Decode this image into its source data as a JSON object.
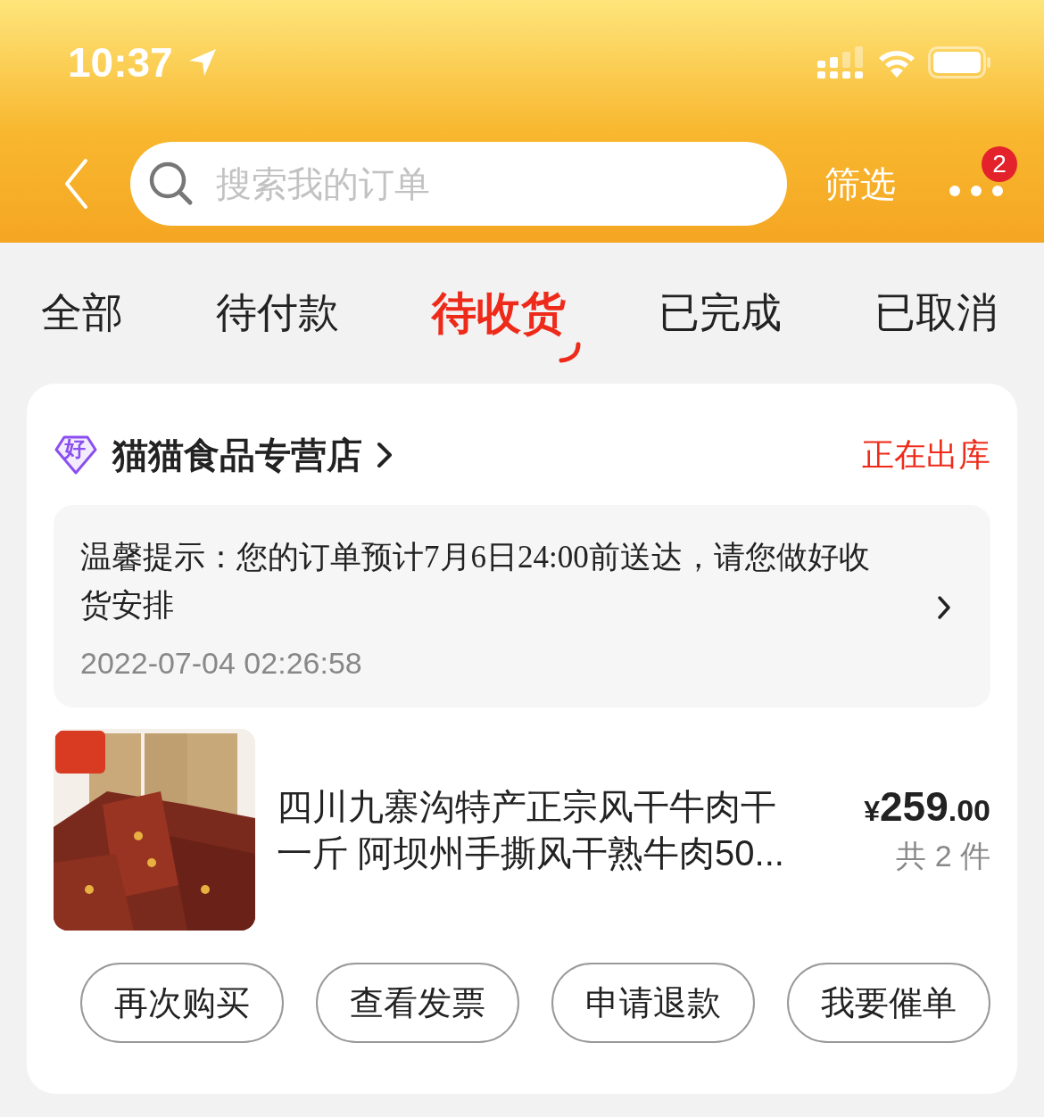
{
  "status_bar": {
    "time": "10:37"
  },
  "header": {
    "search": {
      "placeholder": "搜索我的订单"
    },
    "filter": "筛选",
    "more_badge": "2"
  },
  "tabs": [
    {
      "label": "全部",
      "selected": false
    },
    {
      "label": "待付款",
      "selected": false
    },
    {
      "label": "待收货",
      "selected": true
    },
    {
      "label": "已完成",
      "selected": false
    },
    {
      "label": "已取消",
      "selected": false
    }
  ],
  "order": {
    "store": "猫猫食品专营店",
    "store_badge": "好",
    "status": "正在出库",
    "notice": {
      "text": "温馨提示：您的订单预计7月6日24:00前送达，请您做好收货安排",
      "time": "2022-07-04 02:26:58"
    },
    "product": {
      "title": "四川九寨沟特产正宗风干牛肉干一斤 阿坝州手撕风干熟牛肉50...",
      "price": {
        "symbol": "¥",
        "integer": "259",
        "decimal": ".00"
      },
      "quantity": "共 2 件"
    },
    "actions": [
      "再次购买",
      "查看发票",
      "申请退款",
      "我要催单"
    ]
  }
}
